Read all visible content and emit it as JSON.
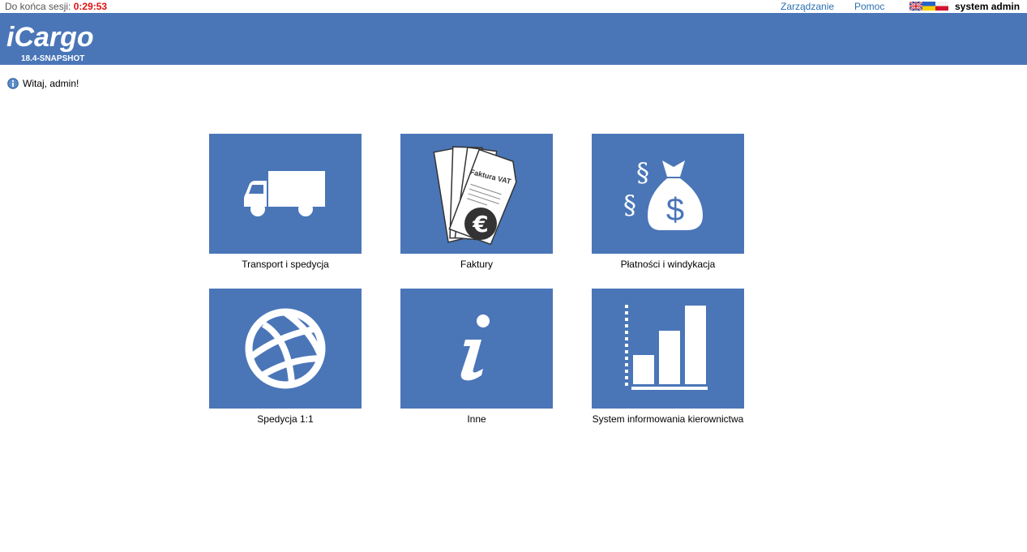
{
  "topbar": {
    "session_label": "Do końca sesji:",
    "session_timer": "0:29:53",
    "manage_link": "Zarządzanie",
    "help_link": "Pomoc",
    "user_name": "system admin"
  },
  "header": {
    "logo_text": "iCargo",
    "version": "18.4-SNAPSHOT",
    "background": "#4a76b8"
  },
  "welcome": {
    "message": "Witaj, admin!"
  },
  "tiles": [
    {
      "label": "Transport i spedycja",
      "icon": "truck-icon"
    },
    {
      "label": "Faktury",
      "icon": "invoice-icon",
      "invoice_title": "Faktura VAT"
    },
    {
      "label": "Płatności i windykacja",
      "icon": "money-bag-icon"
    },
    {
      "label": "Spedycja 1:1",
      "icon": "globe-icon"
    },
    {
      "label": "Inne",
      "icon": "info-icon"
    },
    {
      "label": "System informowania kierownictwa",
      "icon": "bar-chart-icon"
    }
  ]
}
